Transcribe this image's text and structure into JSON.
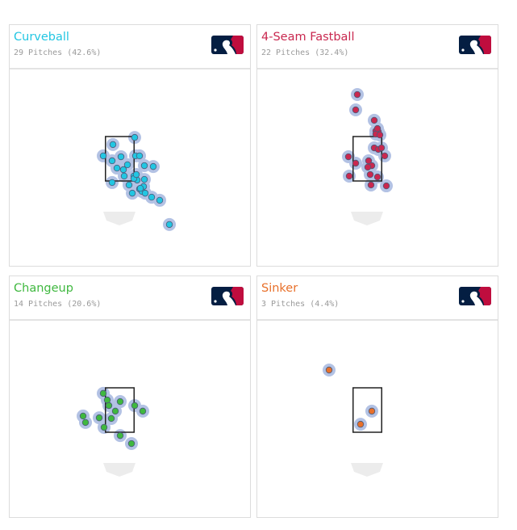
{
  "chart_data": [
    {
      "type": "scatter",
      "title": "Curveball",
      "subtitle": "29 Pitches (42.6%)",
      "color": "#22c6e2",
      "points": [
        [
          0.74,
          3.46
        ],
        [
          -0.34,
          3.14
        ],
        [
          -0.82,
          2.63
        ],
        [
          0.06,
          2.59
        ],
        [
          0.78,
          2.63
        ],
        [
          0.98,
          2.63
        ],
        [
          -0.38,
          2.41
        ],
        [
          0.38,
          2.23
        ],
        [
          -0.14,
          2.08
        ],
        [
          0.18,
          2.01
        ],
        [
          1.22,
          2.19
        ],
        [
          1.66,
          2.15
        ],
        [
          0.22,
          1.72
        ],
        [
          -0.38,
          1.43
        ],
        [
          0.7,
          1.72
        ],
        [
          0.86,
          1.54
        ],
        [
          1.22,
          1.57
        ],
        [
          0.46,
          1.32
        ],
        [
          1.18,
          1.25
        ],
        [
          0.98,
          1.14
        ],
        [
          1.1,
          1.03
        ],
        [
          1.26,
          0.95
        ],
        [
          0.62,
          0.95
        ],
        [
          1.58,
          0.77
        ],
        [
          1.98,
          0.63
        ],
        [
          2.46,
          -0.46
        ],
        [
          0.7,
          1.61
        ],
        [
          1.02,
          1.17
        ],
        [
          0.82,
          1.79
        ]
      ]
    },
    {
      "type": "scatter",
      "title": "4-Seam Fastball",
      "subtitle": "22 Pitches (32.4%)",
      "color": "#c9284f",
      "points": [
        [
          -0.5,
          5.39
        ],
        [
          -0.58,
          4.7
        ],
        [
          0.34,
          4.23
        ],
        [
          0.42,
          3.75
        ],
        [
          0.54,
          3.72
        ],
        [
          0.42,
          3.61
        ],
        [
          0.34,
          2.99
        ],
        [
          0.54,
          2.92
        ],
        [
          0.7,
          2.99
        ],
        [
          0.86,
          2.63
        ],
        [
          -0.94,
          2.59
        ],
        [
          -0.58,
          2.3
        ],
        [
          0.06,
          2.41
        ],
        [
          0.22,
          2.19
        ],
        [
          0.02,
          2.12
        ],
        [
          -0.9,
          1.72
        ],
        [
          0.14,
          1.79
        ],
        [
          0.5,
          1.68
        ],
        [
          0.18,
          1.32
        ],
        [
          0.94,
          1.28
        ],
        [
          0.62,
          3.57
        ],
        [
          0.5,
          3.86
        ]
      ]
    },
    {
      "type": "scatter",
      "title": "Changeup",
      "subtitle": "14 Pitches (20.6%)",
      "color": "#3fb83f",
      "points": [
        [
          -0.82,
          3.25
        ],
        [
          -0.62,
          2.95
        ],
        [
          -0.54,
          2.7
        ],
        [
          0.02,
          2.88
        ],
        [
          0.74,
          2.7
        ],
        [
          1.14,
          2.45
        ],
        [
          -0.22,
          2.45
        ],
        [
          -1.82,
          2.23
        ],
        [
          -1.02,
          2.15
        ],
        [
          -1.7,
          1.94
        ],
        [
          -0.42,
          2.12
        ],
        [
          -0.78,
          1.72
        ],
        [
          0.02,
          1.35
        ],
        [
          0.58,
          0.99
        ]
      ]
    },
    {
      "type": "scatter",
      "title": "Sinker",
      "subtitle": "3 Pitches (4.4%)",
      "color": "#e8702a",
      "points": [
        [
          -1.9,
          4.3
        ],
        [
          0.22,
          2.45
        ],
        [
          -0.34,
          1.86
        ]
      ]
    }
  ],
  "strike_zone": {
    "x": [
      -0.71,
      0.71
    ],
    "z": [
      1.5,
      3.5
    ]
  },
  "logo_colors": {
    "navy": "#041e42",
    "red": "#bf0d3e"
  }
}
